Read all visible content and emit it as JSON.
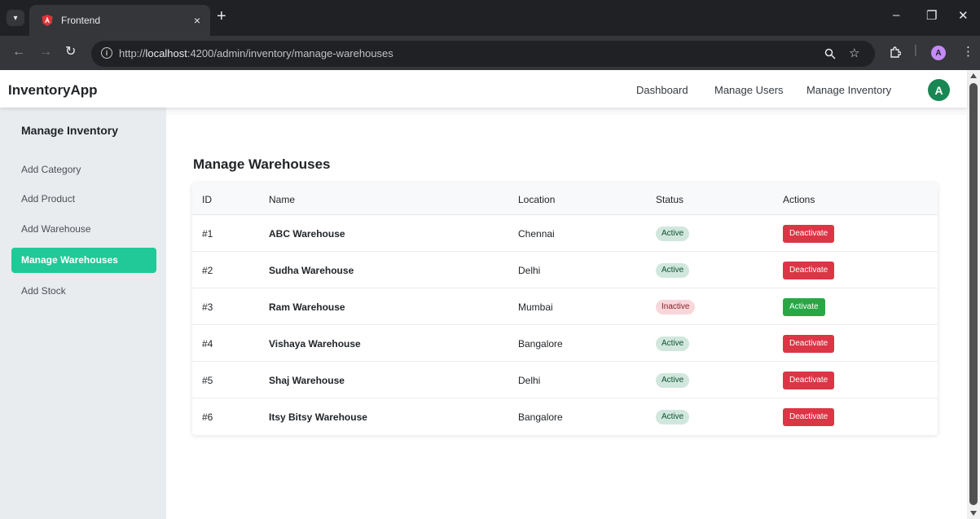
{
  "browser": {
    "tab_title": "Frontend",
    "tab_close": "×",
    "new_tab": "+",
    "url_prefix": "http://",
    "url_host": "localhost",
    "url_rest": ":4200/admin/inventory/manage-warehouses",
    "profile_letter": "A",
    "window_controls": {
      "minimize": "–",
      "restore": "❐",
      "close": "✕"
    }
  },
  "header": {
    "brand": "InventoryApp",
    "nav": [
      "Dashboard",
      "Manage Users",
      "Manage Inventory"
    ],
    "avatar_letter": "A"
  },
  "sidebar": {
    "title": "Manage Inventory",
    "items": [
      {
        "label": "Add Category",
        "active": false
      },
      {
        "label": "Add Product",
        "active": false
      },
      {
        "label": "Add Warehouse",
        "active": false
      },
      {
        "label": "Manage Warehouses",
        "active": true
      },
      {
        "label": "Add Stock",
        "active": false
      }
    ]
  },
  "main": {
    "title": "Manage Warehouses",
    "columns": [
      "ID",
      "Name",
      "Location",
      "Status",
      "Actions"
    ],
    "rows": [
      {
        "id": "#1",
        "name": "ABC Warehouse",
        "location": "Chennai",
        "status": "Active",
        "action": "Deactivate"
      },
      {
        "id": "#2",
        "name": "Sudha Warehouse",
        "location": "Delhi",
        "status": "Active",
        "action": "Deactivate"
      },
      {
        "id": "#3",
        "name": "Ram Warehouse",
        "location": "Mumbai",
        "status": "Inactive",
        "action": "Activate"
      },
      {
        "id": "#4",
        "name": "Vishaya Warehouse",
        "location": "Bangalore",
        "status": "Active",
        "action": "Deactivate"
      },
      {
        "id": "#5",
        "name": "Shaj Warehouse",
        "location": "Delhi",
        "status": "Active",
        "action": "Deactivate"
      },
      {
        "id": "#6",
        "name": "Itsy Bitsy Warehouse",
        "location": "Bangalore",
        "status": "Active",
        "action": "Deactivate"
      }
    ]
  },
  "colors": {
    "sidebar_active": "#20c997",
    "active_badge_bg": "#d1e7dd",
    "inactive_badge_bg": "#f8d7da",
    "deactivate_button": "#dc3545",
    "activate_button": "#28a745",
    "avatar_bg": "#198754"
  },
  "icons": {
    "tab_dropdown": "chevron-down-icon",
    "favicon": "angular-icon",
    "back": "back-arrow-icon",
    "forward": "forward-arrow-icon",
    "reload": "reload-icon",
    "site_info": "info-icon",
    "zoom": "zoom-icon",
    "bookmark": "star-icon",
    "extensions": "puzzle-icon",
    "menu": "kebab-menu-icon"
  }
}
